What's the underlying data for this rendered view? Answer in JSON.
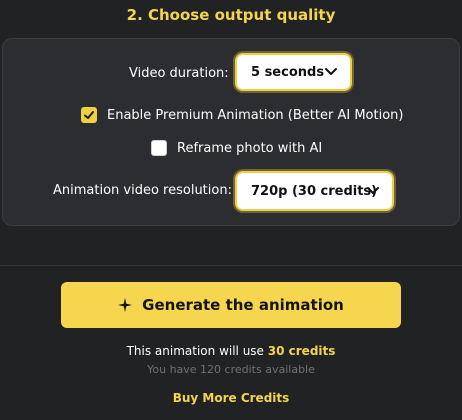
{
  "section": {
    "title": "2.  Choose output quality"
  },
  "options": {
    "duration_label": "Video duration:",
    "duration_value": "5 seconds",
    "premium_label": "Enable Premium Animation (Better AI Motion)",
    "premium_checked": true,
    "reframe_label": "Reframe photo with AI",
    "reframe_checked": false,
    "resolution_label": "Animation video resolution:",
    "resolution_value": "720p (30 credits)"
  },
  "cta": {
    "label": "Generate the animation"
  },
  "usage": {
    "prefix": "This animation will use ",
    "credits": "30 credits",
    "available": "You have 120 credits available",
    "buy_label": "Buy More Credits"
  },
  "colors": {
    "accent": "#f5d54c",
    "background": "#212224",
    "panel": "#2b2d30"
  },
  "icons": [
    "chevron-down-icon",
    "check-icon",
    "sparkle-icon"
  ]
}
